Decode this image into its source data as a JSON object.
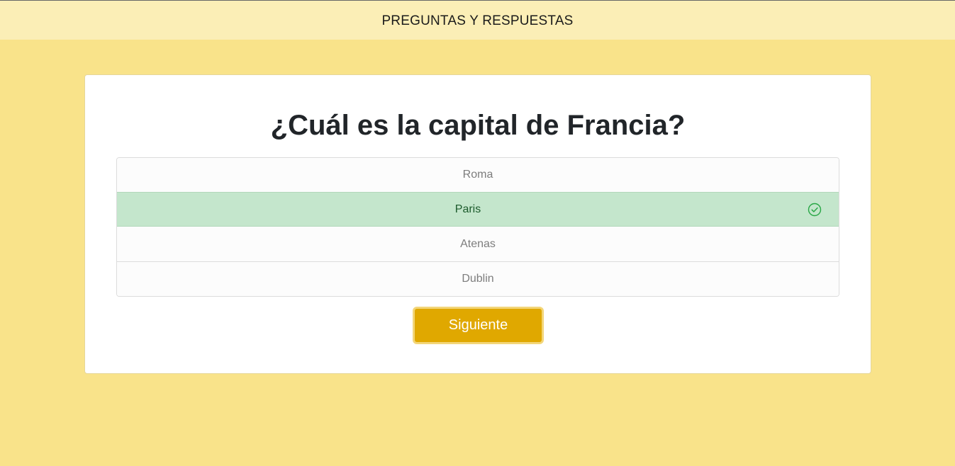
{
  "header": {
    "title": "PREGUNTAS Y RESPUESTAS"
  },
  "quiz": {
    "question": "¿Cuál es la capital de Francia?",
    "answers": [
      {
        "label": "Roma",
        "state": "default"
      },
      {
        "label": "Paris",
        "state": "correct"
      },
      {
        "label": "Atenas",
        "state": "default"
      },
      {
        "label": "Dublin",
        "state": "default"
      }
    ],
    "correct_icon": "check-circle-icon",
    "next_label": "Siguiente"
  },
  "colors": {
    "background": "#f9e38a",
    "header_background": "#fbeeb6",
    "correct_background": "#c4e6cc",
    "correct_icon": "#28a745",
    "button": "#e0a800"
  }
}
